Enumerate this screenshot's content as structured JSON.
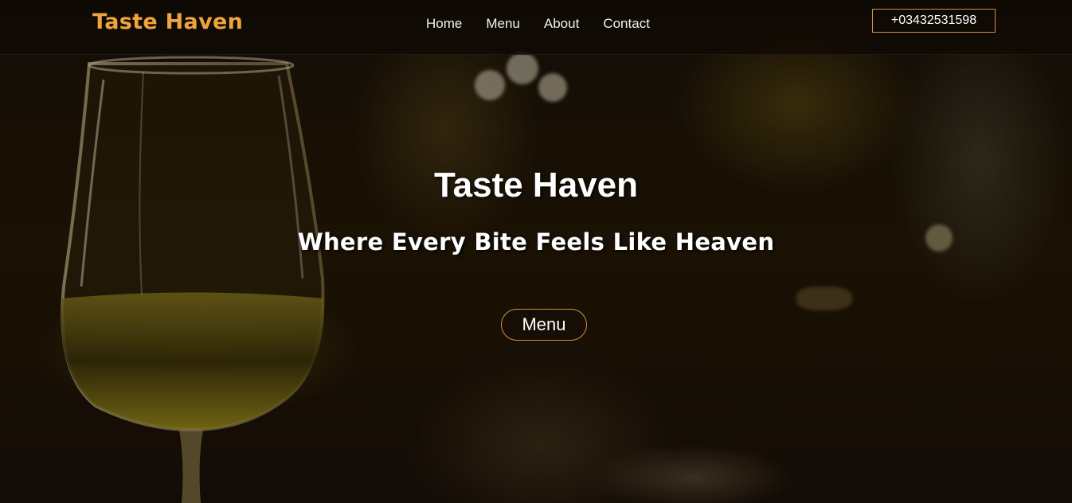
{
  "header": {
    "logo": "Taste Haven",
    "nav": {
      "home": "Home",
      "menu": "Menu",
      "about": "About",
      "contact": "Contact"
    },
    "phone": "+03432531598"
  },
  "hero": {
    "title": "Taste Haven",
    "subtitle": "Where Every Bite Feels Like Heaven",
    "button_label": "Menu"
  },
  "colors": {
    "accent": "#f0a43c",
    "button_border": "#d98d43",
    "text": "#ffffff"
  }
}
